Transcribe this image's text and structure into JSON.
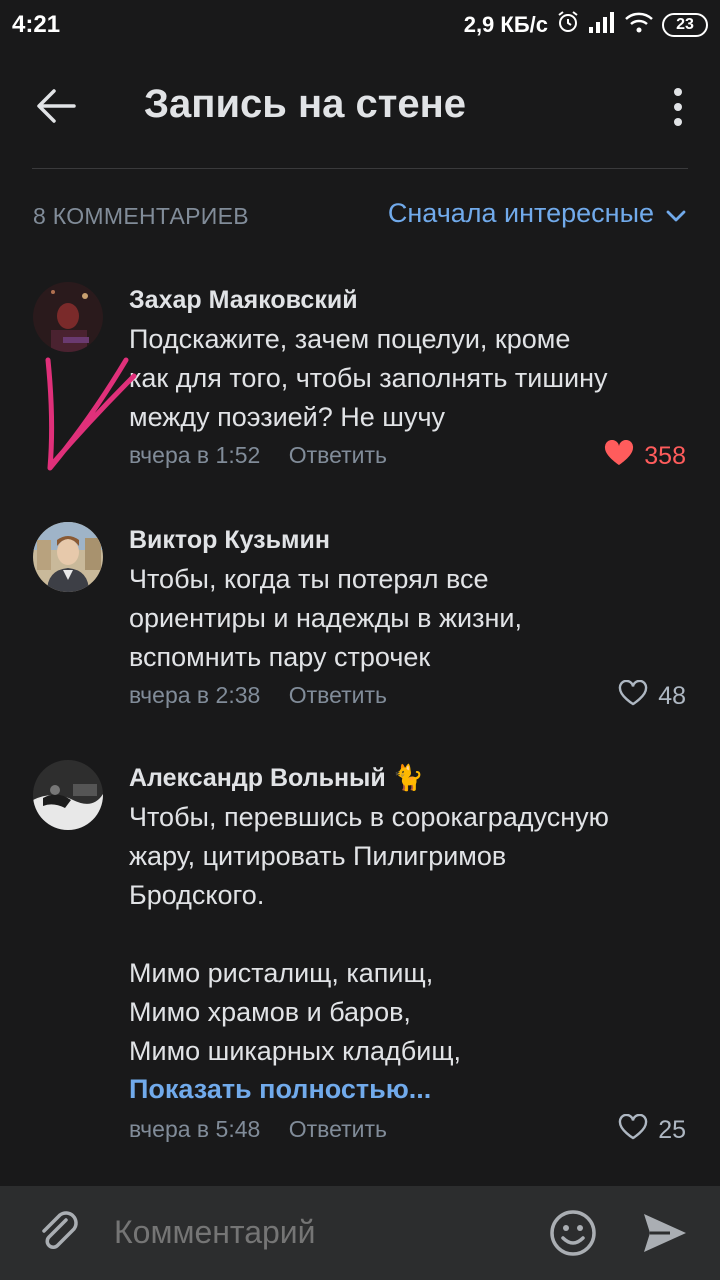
{
  "status_bar": {
    "time": "4:21",
    "net_speed": "2,9 КБ/с",
    "battery": "23",
    "icons": [
      "alarm-icon",
      "signal-icon",
      "wifi-icon",
      "battery-icon"
    ]
  },
  "header": {
    "title": "Запись на стене",
    "icons": [
      "back-arrow-icon",
      "more-vertical-icon"
    ]
  },
  "comments_bar": {
    "count_label": "8 КОММЕНТАРИЕВ",
    "sort_label": "Сначала интересные"
  },
  "comments": [
    {
      "author": "Захар Маяковский",
      "text": "Подскажите, зачем поцелуи, кроме\nкак для того, чтобы заполнять тишину\nмежду поэзией? Не шучу",
      "time": "вчера в 1:52",
      "reply": "Ответить",
      "likes": "358",
      "liked": true
    },
    {
      "author": "Виктор Кузьмин",
      "text": "Чтобы, когда ты потерял все\nориентиры и надежды в жизни,\nвспомнить пару строчек",
      "time": "вчера в 2:38",
      "reply": "Ответить",
      "likes": "48",
      "liked": false
    },
    {
      "author": "Александр Вольный 🐈",
      "text": "Чтобы, перевшись в сорокаградусную\nжару, цитировать Пилигримов\nБродского.\n\nМимо ристалищ, капищ,\nМимо храмов и баров,\nМимо шикарных кладбищ,",
      "show_more": "Показать полностью...",
      "time": "вчера в 5:48",
      "reply": "Ответить",
      "likes": "25",
      "liked": false
    }
  ],
  "input_bar": {
    "placeholder": "Комментарий",
    "icons": [
      "attach-icon",
      "emoji-icon",
      "send-icon"
    ]
  },
  "colors": {
    "background": "#19191a",
    "accent": "#71aaeb",
    "like_active": "#ff5c5c",
    "secondary_text": "#818c99",
    "annotation": "#e0307a"
  }
}
